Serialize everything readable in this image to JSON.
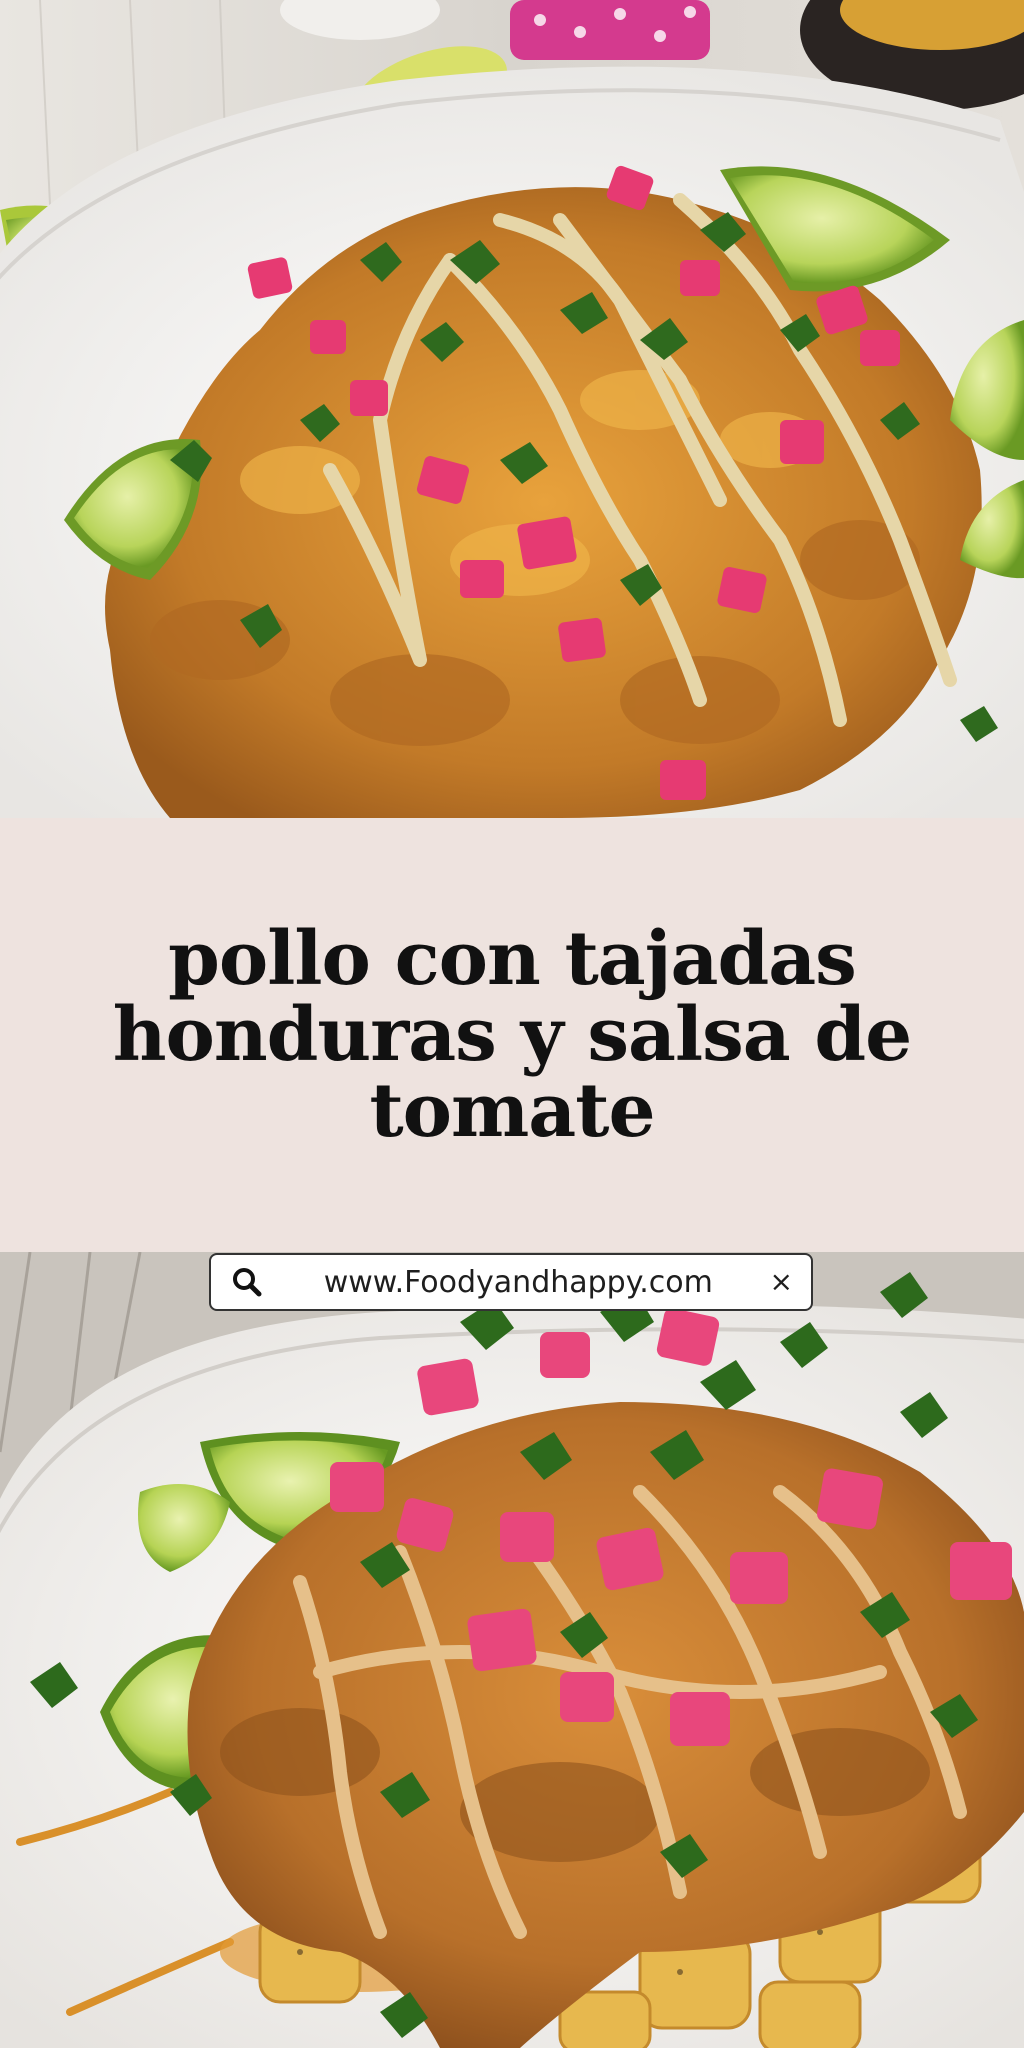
{
  "title": "pollo con tajadas honduras y salsa de tomate",
  "search_bar": {
    "url": "www.Foodyandhappy.com",
    "close_glyph": "×",
    "search_icon": "search-icon",
    "close_icon": "close-icon"
  },
  "colors": {
    "title_band": "#eee3df",
    "title_text": "#111111",
    "lime": "#9cc63a",
    "onion": "#e63a72",
    "cilantro": "#2f6a1e",
    "sauce": "#e6d6a8",
    "fried_chicken": "#c8862e"
  }
}
